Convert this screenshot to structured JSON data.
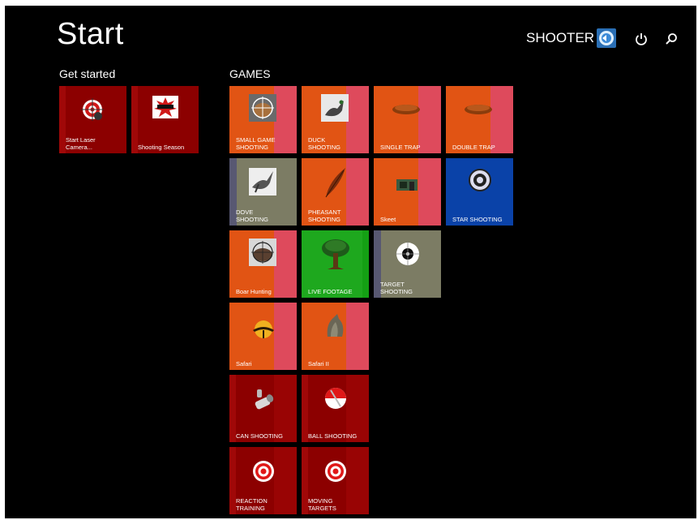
{
  "header": {
    "title": "Start",
    "user_name": "SHOOTER"
  },
  "groups": {
    "get_started": "Get started",
    "games": "GAMES"
  },
  "tiles": {
    "start_laser_camera": "Start Laser\nCamera...",
    "shooting_season": "Shooting Season",
    "small_game_shooting": "SMALL GAME\nSHOOTING",
    "duck_shooting": "DUCK\nSHOOTING",
    "single_trap": "SINGLE TRAP",
    "double_trap": "DOUBLE TRAP",
    "dove_shooting": "DOVE\nSHOOTING",
    "pheasant_shooting": "PHEASANT\nSHOOTING",
    "skeet": "Skeet",
    "star_shooting": "STAR SHOOTING",
    "boar_hunting": "Boar Hunting",
    "live_footage": "LIVE FOOTAGE",
    "target_shooting": "TARGET\nSHOOTING",
    "safari": "Safari",
    "safari_ii": "Safari II",
    "can_shooting": "CAN SHOOTING",
    "ball_shooting": "BALL SHOOTING",
    "reaction_training": "REACTION\nTRAINING",
    "moving_targets": "MOVING\nTARGETS"
  },
  "colors": {
    "orange": "#e15414",
    "dark_red": "#8c0000",
    "olive": "#7c7c64",
    "green": "#1ea81e",
    "blue": "#0a42a8"
  }
}
